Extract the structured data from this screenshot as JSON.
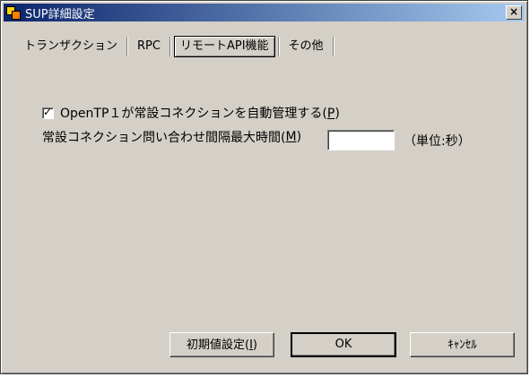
{
  "window": {
    "title": "SUP詳細設定",
    "close_label": "×"
  },
  "tabs": [
    {
      "label": "トランザクション"
    },
    {
      "label": "RPC"
    },
    {
      "label": "リモートAPI機能"
    },
    {
      "label": "その他"
    }
  ],
  "auto_manage": {
    "prefix": "OpenTP１が常設コネクションを自動管理する(",
    "accel": "P",
    "suffix": ")",
    "checked": true
  },
  "interval": {
    "prefix": "常設コネクション問い合わせ間隔最大時間(",
    "accel": "M",
    "suffix": ")",
    "value": "",
    "unit": "（単位:秒）"
  },
  "buttons": {
    "reset": {
      "prefix": "初期値設定(",
      "accel": "I",
      "suffix": ")"
    },
    "ok": "OK",
    "cancel": "ｷｬﾝｾﾙ"
  }
}
